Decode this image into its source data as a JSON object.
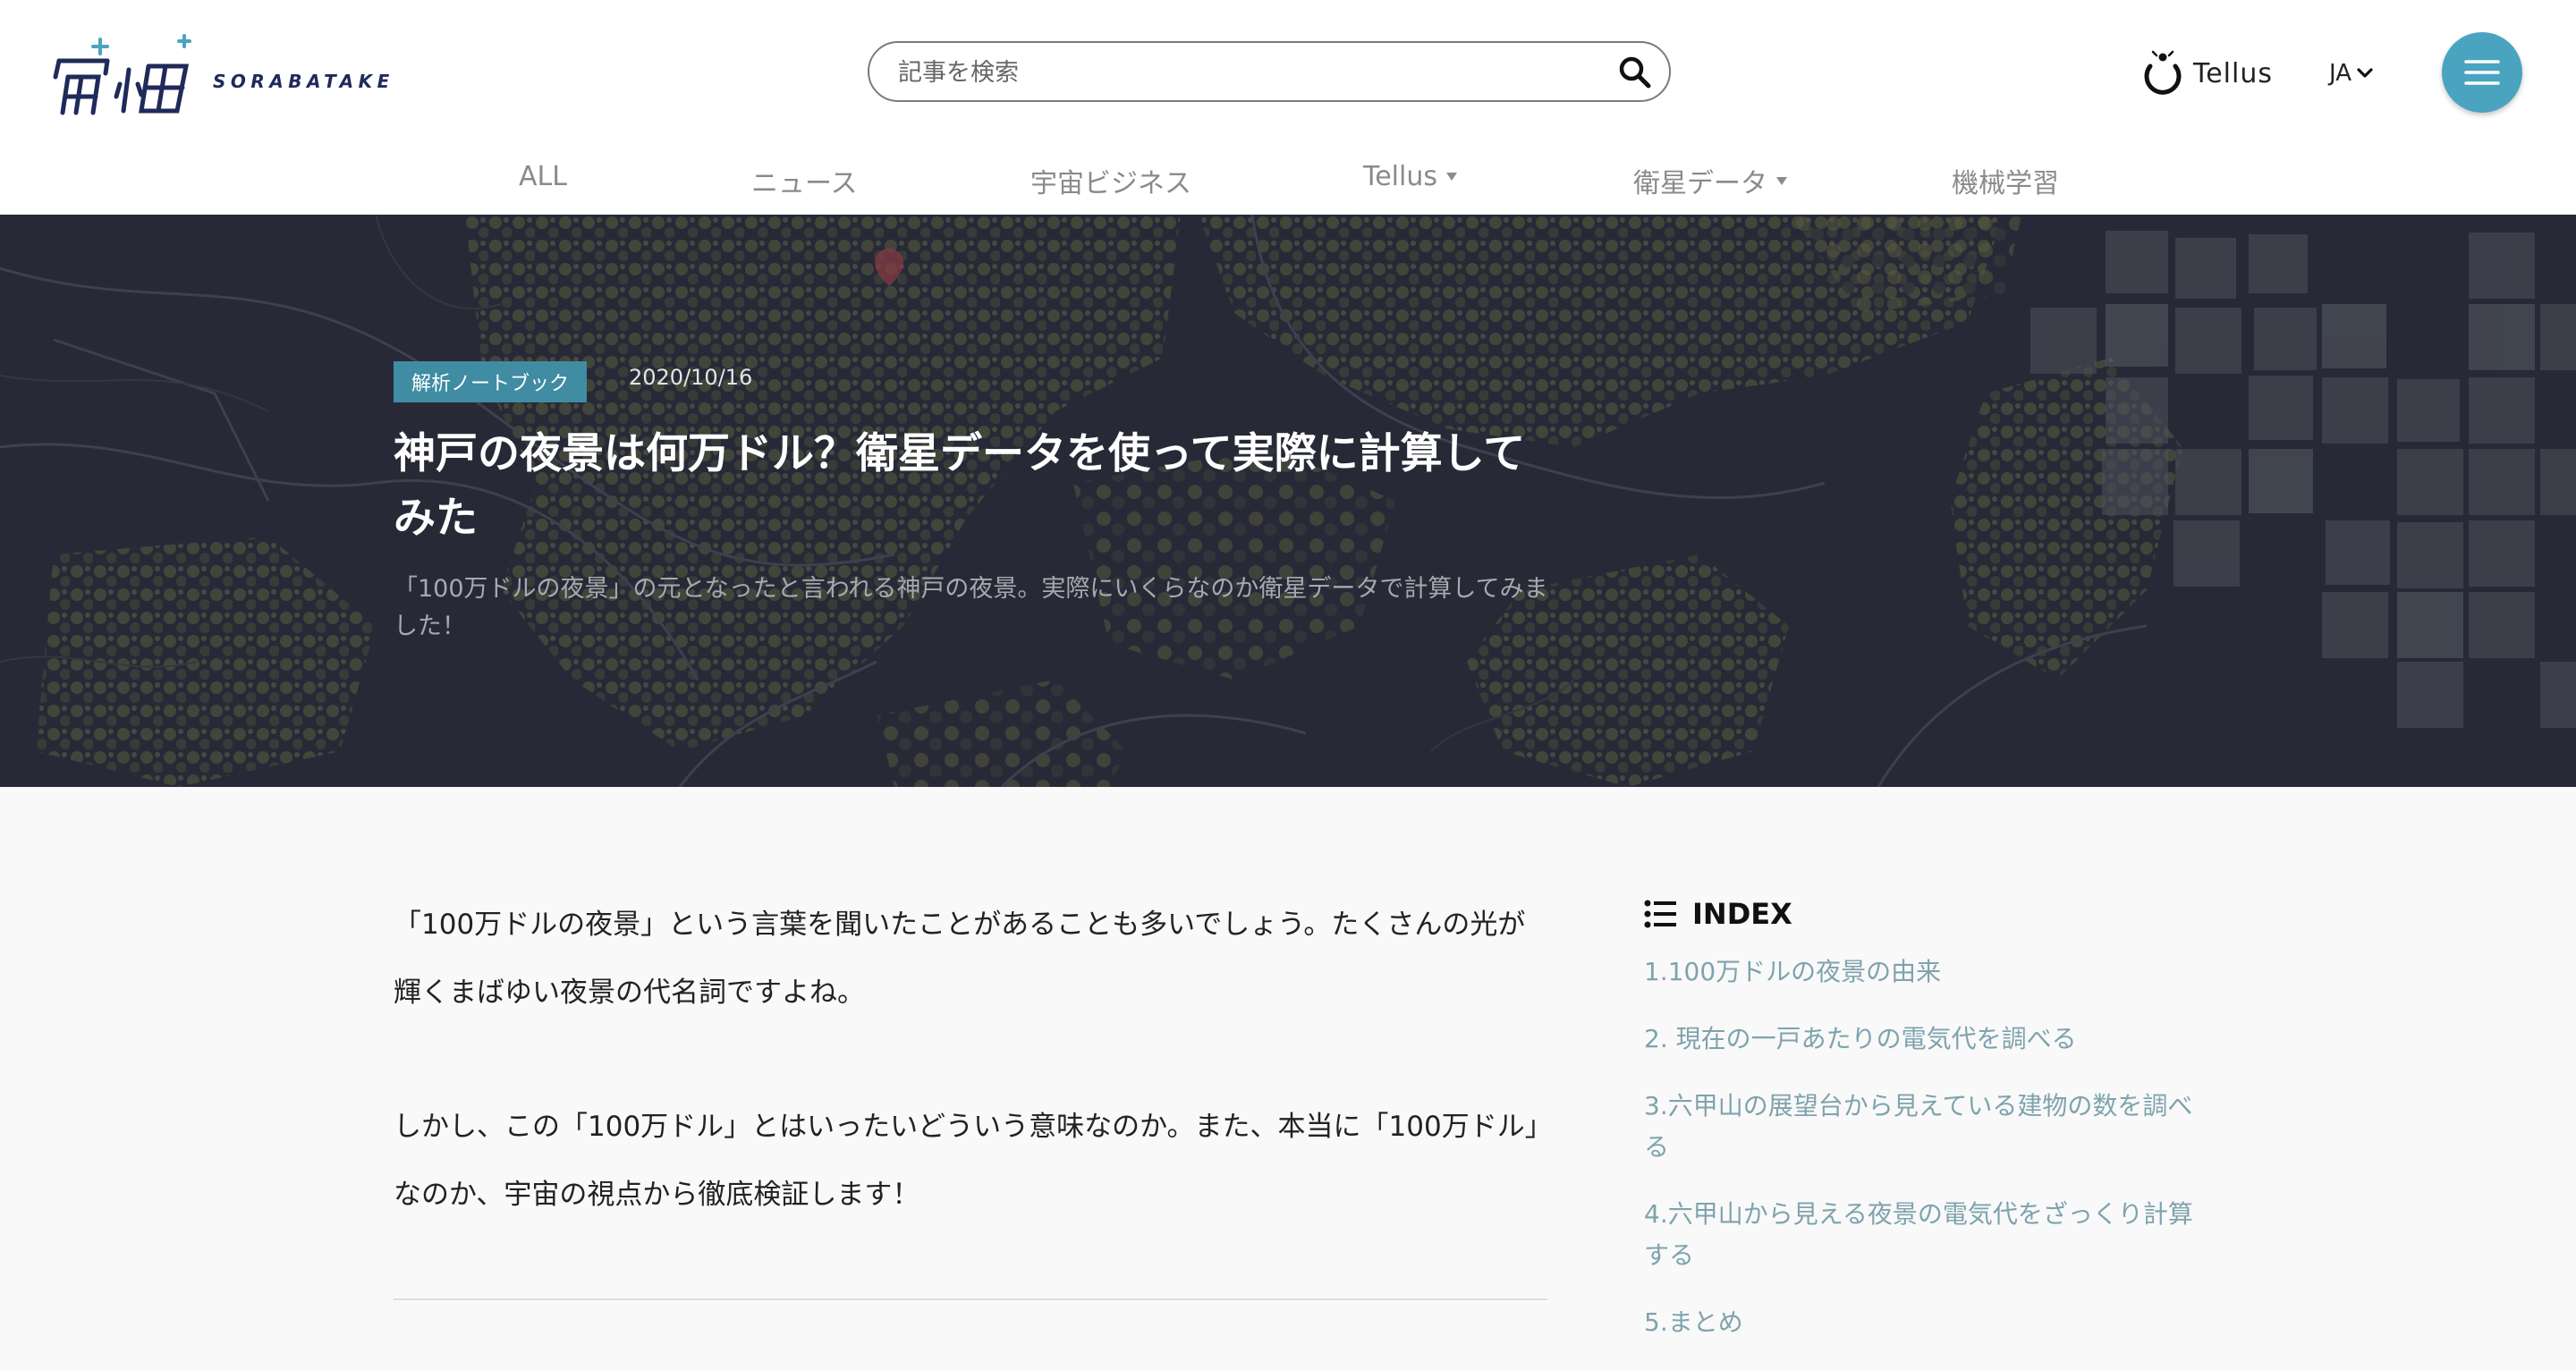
{
  "header": {
    "logo_text": "SORABATAKE",
    "search_placeholder": "記事を検索",
    "tellus_label": "Tellus",
    "language": "JA"
  },
  "nav": {
    "items": [
      {
        "label": "ALL",
        "has_dropdown": false
      },
      {
        "label": "ニュース",
        "has_dropdown": false
      },
      {
        "label": "宇宙ビジネス",
        "has_dropdown": false
      },
      {
        "label": "Tellus",
        "has_dropdown": true
      },
      {
        "label": "衛星データ",
        "has_dropdown": true
      },
      {
        "label": "機械学習",
        "has_dropdown": false
      }
    ]
  },
  "hero": {
    "category": "解析ノートブック",
    "date": "2020/10/16",
    "title": "神戸の夜景は何万ドル？衛星データを使って実際に計算してみた",
    "subtitle": "「100万ドルの夜景」の元となったと言われる神戸の夜景。実際にいくらなのか衛星データで計算してみました！"
  },
  "article": {
    "paragraphs": [
      "「100万ドルの夜景」という言葉を聞いたことがあることも多いでしょう。たくさんの光が輝くまばゆい夜景の代名詞ですよね。",
      "しかし、この「100万ドル」とはいったいどういう意味なのか。また、本当に「100万ドル」なのか、宇宙の視点から徹底検証します！"
    ]
  },
  "index": {
    "title": "INDEX",
    "items": [
      "1.100万ドルの夜景の由来",
      "2. 現在の一戸あたりの電気代を調べる",
      "3.六甲山の展望台から見えている建物の数を調べる",
      "4.六甲山から見える夜景の電気代をざっくり計算する",
      "5.まとめ"
    ]
  },
  "colors": {
    "accent": "#4aa4c0",
    "badge": "#3f8ca3",
    "hero_bg": "#272a36",
    "index_link": "#7ea3ad",
    "logo": "#1f2a5a"
  }
}
